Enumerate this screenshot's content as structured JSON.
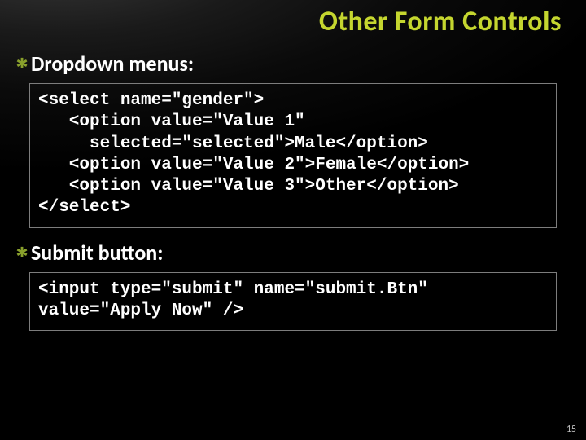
{
  "slide": {
    "title": "Other Form Controls",
    "bullets": {
      "b1": {
        "icon": "✱",
        "text": "Dropdown menus:"
      },
      "b2": {
        "icon": "✱",
        "text": "Submit button:"
      }
    },
    "code1": "<select name=\"gender\">\n   <option value=\"Value 1\"\n     selected=\"selected\">Male</option>\n   <option value=\"Value 2\">Female</option>\n   <option value=\"Value 3\">Other</option>\n</select>",
    "code2": "<input type=\"submit\" name=\"submit.Btn\"\nvalue=\"Apply Now\" />",
    "page_number": "15"
  }
}
